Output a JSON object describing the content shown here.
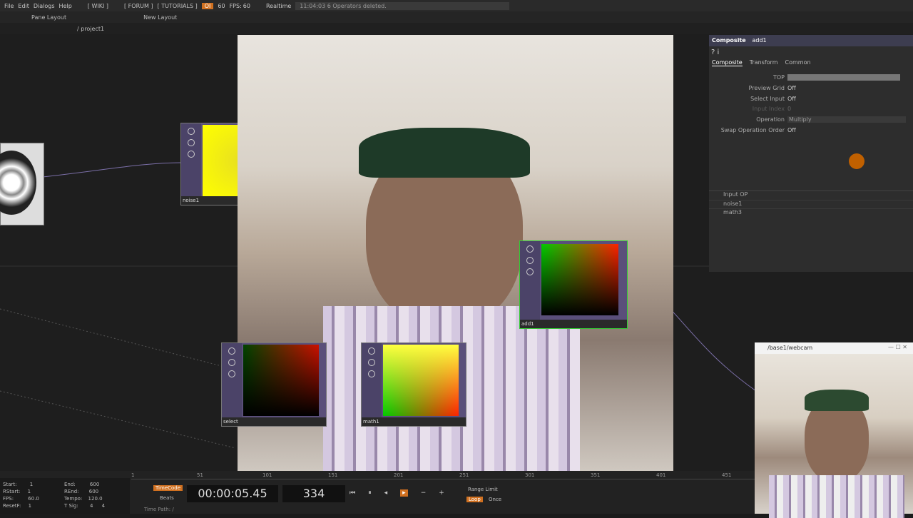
{
  "menubar": {
    "items": [
      "File",
      "Edit",
      "Dialogs",
      "Help"
    ],
    "links": [
      "[ WIKI ]",
      "[ FORUM ]",
      "[ TUTORIALS ]"
    ],
    "oi": "OI",
    "fps_value": "60",
    "fps_label": "FPS:",
    "fps": "60",
    "realtime": "Realtime",
    "message": "11:04:03 6 Operators deleted."
  },
  "tabbar": {
    "pane_layout": "Pane Layout",
    "new_layout": "New Layout"
  },
  "pathbar": {
    "path": "/ project1"
  },
  "nodes": {
    "noise1": "noise1",
    "add1": "add1",
    "select": "select",
    "math1": "math1"
  },
  "params": {
    "op_type": "Composite",
    "op_name": "add1",
    "tabs": [
      "Composite",
      "Transform",
      "Common"
    ],
    "rows": [
      {
        "label": "TOP",
        "value": ""
      },
      {
        "label": "Preview Grid",
        "value": "Off"
      },
      {
        "label": "Select Input",
        "value": "Off"
      },
      {
        "label": "Input Index",
        "value": "0"
      },
      {
        "label": "Operation",
        "value": "Multiply"
      },
      {
        "label": "Swap Operation Order",
        "value": "Off"
      }
    ],
    "inputs": [
      "Input OP",
      "noise1",
      "math3"
    ]
  },
  "timeline": {
    "start": "1",
    "end": "600",
    "rstart": "1",
    "rend": "600",
    "fps": "60.0",
    "tempo": "120.0",
    "resetf": "1",
    "tsig_a": "4",
    "tsig_b": "4",
    "labels": {
      "start": "Start:",
      "end": "End:",
      "rstart": "RStart:",
      "rend": "REnd:",
      "fps": "FPS:",
      "tempo": "Tempo:",
      "resetf": "ResetF:",
      "tsig": "T Sig:"
    },
    "timecode_btn": "TimeCode",
    "beats_btn": "Beats",
    "timecode": "00:00:05.45",
    "frame": "334",
    "range_limit": "Range Limit",
    "loop": "Loop",
    "once": "Once",
    "time_path": "Time Path: /",
    "ticks": [
      "1",
      "51",
      "101",
      "151",
      "201",
      "251",
      "301",
      "351",
      "401",
      "451"
    ]
  },
  "webcam": {
    "title": "/base1/webcam"
  }
}
